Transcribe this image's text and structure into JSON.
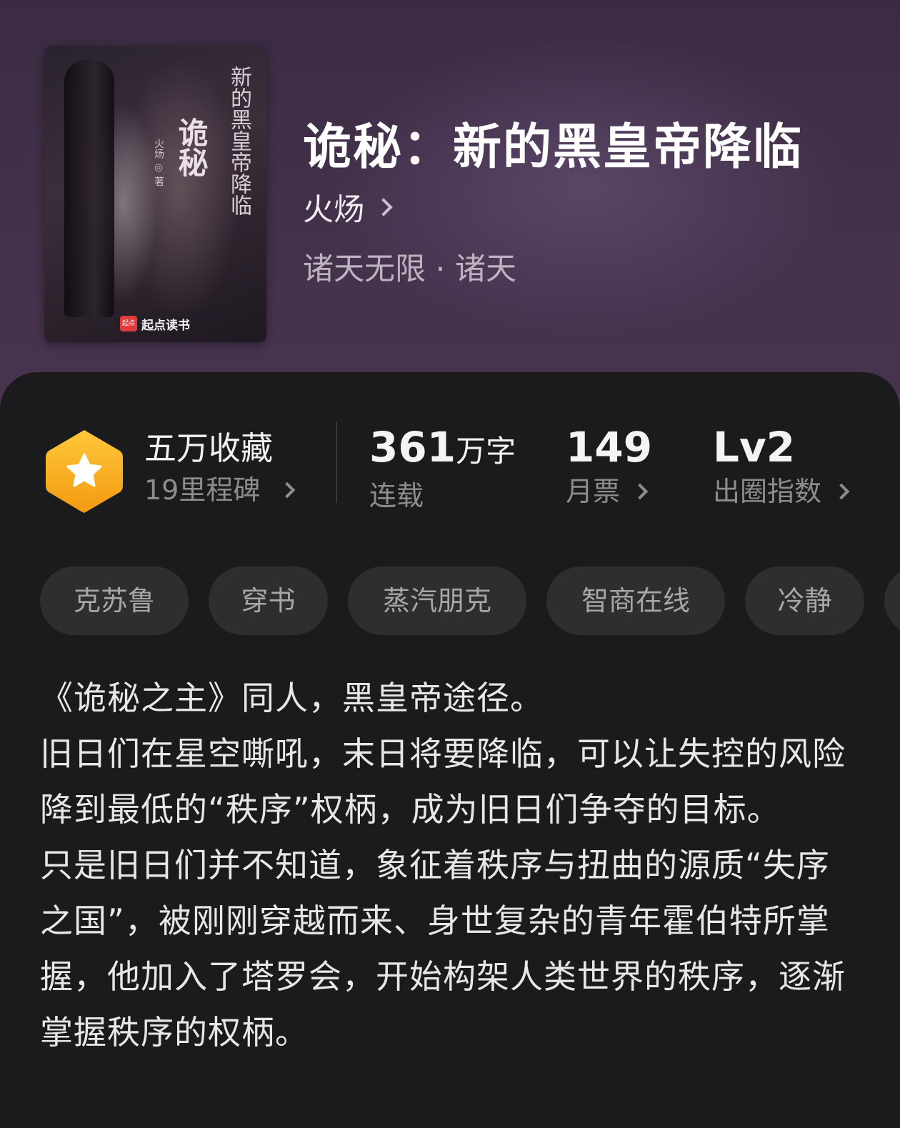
{
  "book": {
    "title": "诡秘：新的黑皇帝降临",
    "author": "火炀",
    "genre": "诸天无限 · 诸天"
  },
  "cover": {
    "title_vertical": "诡秘",
    "subtitle_vertical": "新的黑皇帝降临",
    "author_mark": "火炀 ◎ 著",
    "publisher": "起点读书",
    "publisher_badge": "起点"
  },
  "stats": {
    "milestone_title": "五万收藏",
    "milestone_sub": "19里程碑",
    "words_value": "361",
    "words_unit": "万字",
    "words_label": "连载",
    "monthly_tickets_value": "149",
    "monthly_tickets_label": "月票",
    "influence_value": "Lv2",
    "influence_label": "出圈指数"
  },
  "tags": [
    "克苏鲁",
    "穿书",
    "蒸汽朋克",
    "智商在线",
    "冷静"
  ],
  "synopsis": [
    "《诡秘之主》同人，黑皇帝途径。",
    "旧日们在星空嘶吼，末日将要降临，可以让失控的风险降到最低的“秩序”权柄，成为旧日们争夺的目标。",
    "只是旧日们并不知道，象征着秩序与扭曲的源质“失序之国”，被刚刚穿越而来、身世复杂的青年霍伯特所掌握，他加入了塔罗会，开始构架人类世界的秩序，逐渐掌握秩序的权柄。"
  ],
  "colors": {
    "hero_bg": "#423049",
    "panel_bg": "#1b1a1c",
    "badge_orange": "#f5a623",
    "tag_bg": "#2e2d30"
  },
  "icons": [
    "star-hexagon-badge-icon",
    "chevron-right-icon"
  ]
}
